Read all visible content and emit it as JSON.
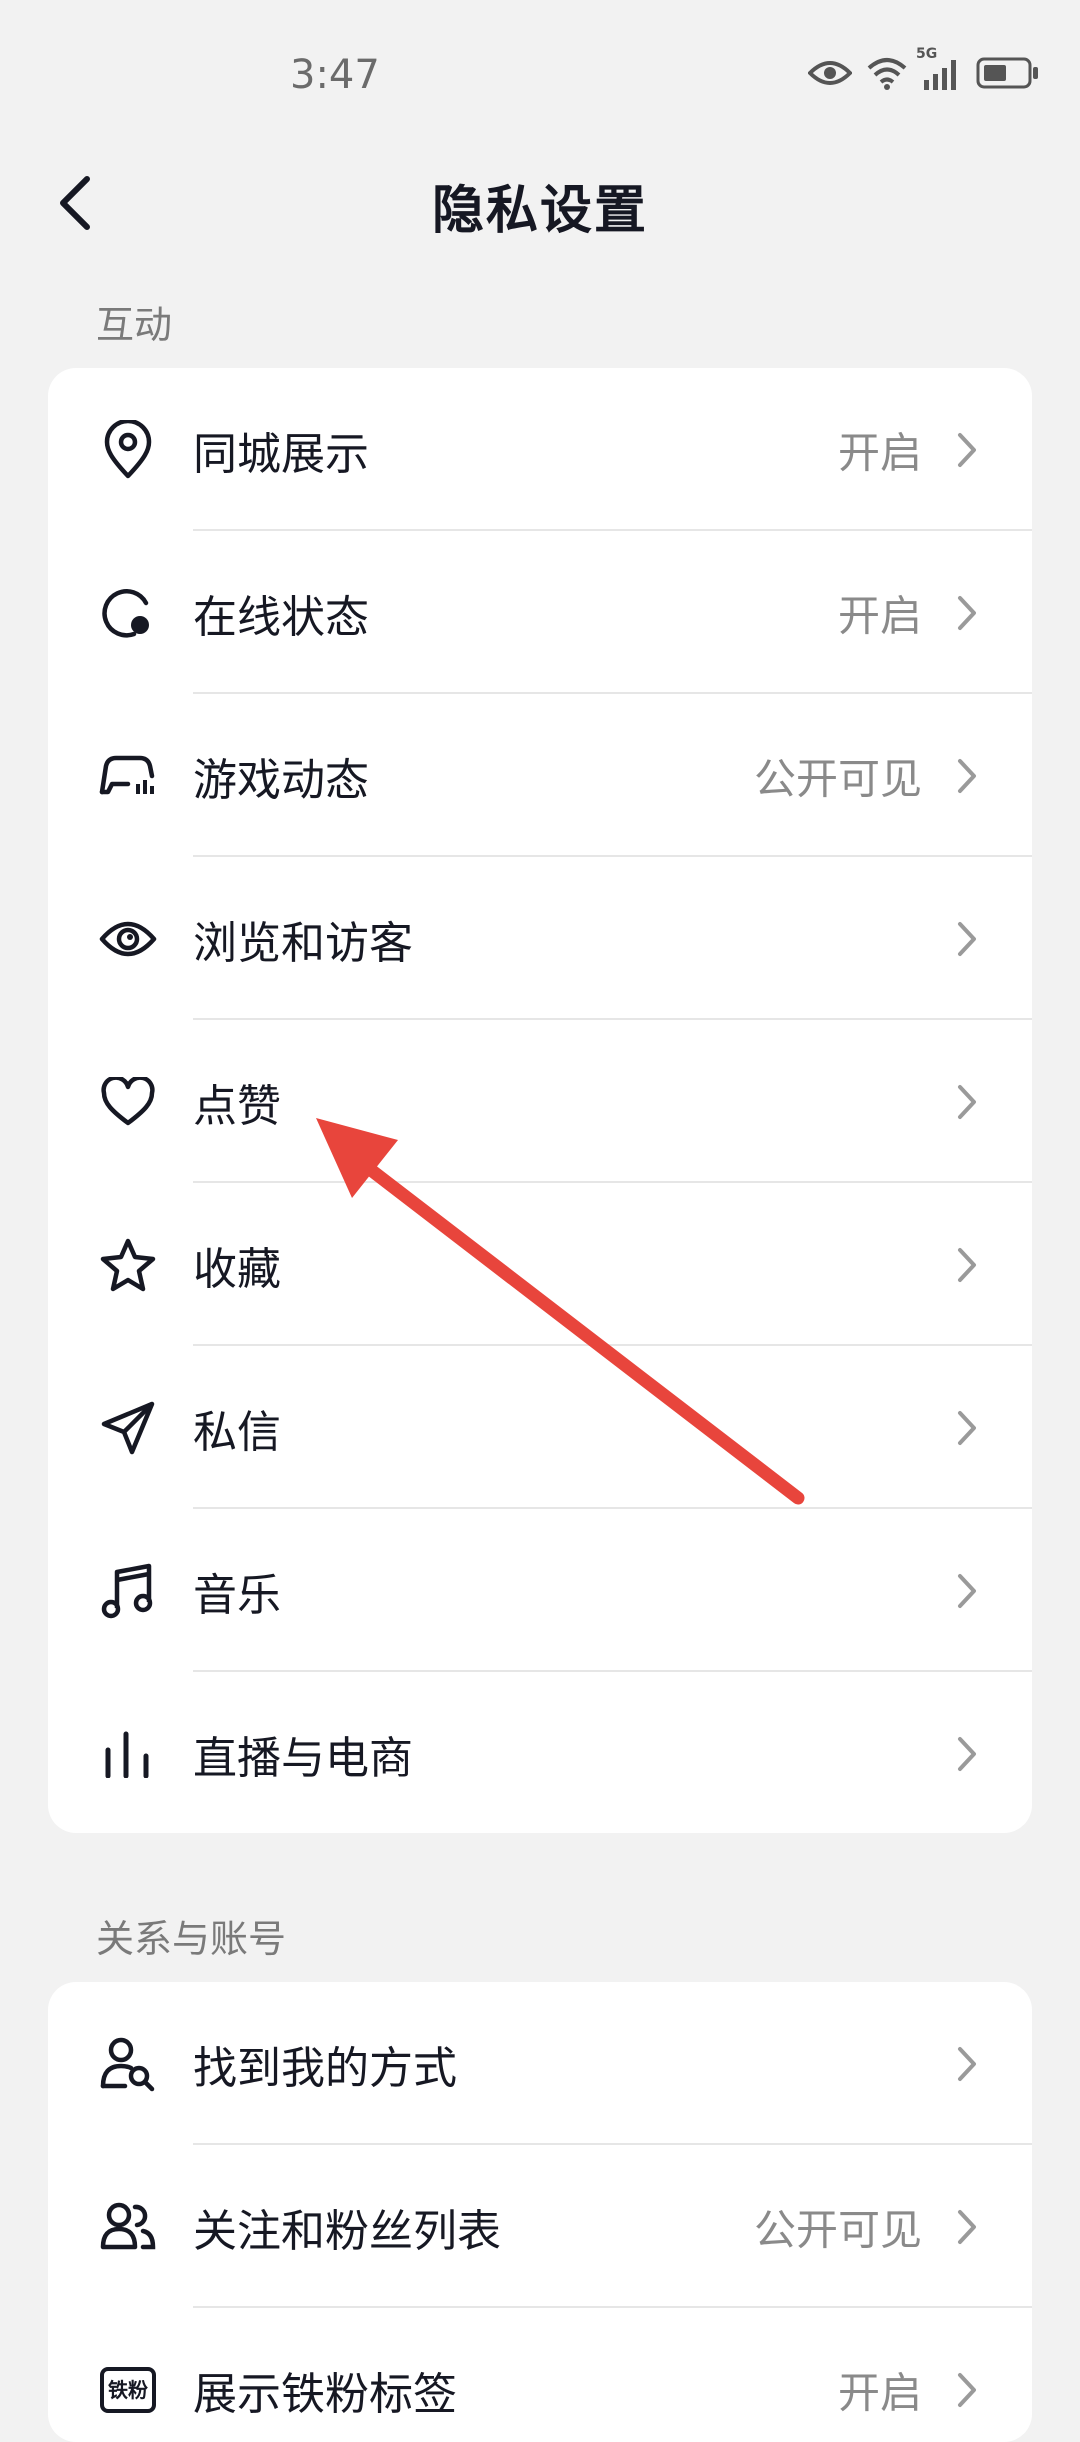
{
  "status_bar": {
    "time": "3:47",
    "network": "5G",
    "icons": [
      "eye-icon",
      "wifi-icon",
      "signal-icon",
      "battery-icon"
    ]
  },
  "header": {
    "title": "隐私设置",
    "back_icon": "back-chevron-icon"
  },
  "sections": [
    {
      "title": "互动",
      "items": [
        {
          "label": "同城展示",
          "value": "开启",
          "icon": "location-pin-icon"
        },
        {
          "label": "在线状态",
          "value": "开启",
          "icon": "online-status-icon"
        },
        {
          "label": "游戏动态",
          "value": "公开可见",
          "icon": "game-controller-icon"
        },
        {
          "label": "浏览和访客",
          "value": "",
          "icon": "eye-icon"
        },
        {
          "label": "点赞",
          "value": "",
          "icon": "heart-icon"
        },
        {
          "label": "收藏",
          "value": "",
          "icon": "star-icon"
        },
        {
          "label": "私信",
          "value": "",
          "icon": "send-icon"
        },
        {
          "label": "音乐",
          "value": "",
          "icon": "music-note-icon"
        },
        {
          "label": "直播与电商",
          "value": "",
          "icon": "live-bars-icon"
        }
      ]
    },
    {
      "title": "关系与账号",
      "items": [
        {
          "label": "找到我的方式",
          "value": "",
          "icon": "person-search-icon"
        },
        {
          "label": "关注和粉丝列表",
          "value": "公开可见",
          "icon": "people-icon"
        },
        {
          "label": "展示铁粉标签",
          "value": "开启",
          "icon": "fan-badge-icon",
          "badge_text": "铁粉"
        }
      ]
    }
  ],
  "annotation": {
    "type": "arrow",
    "color": "#e8453c",
    "points_to": "点赞"
  }
}
